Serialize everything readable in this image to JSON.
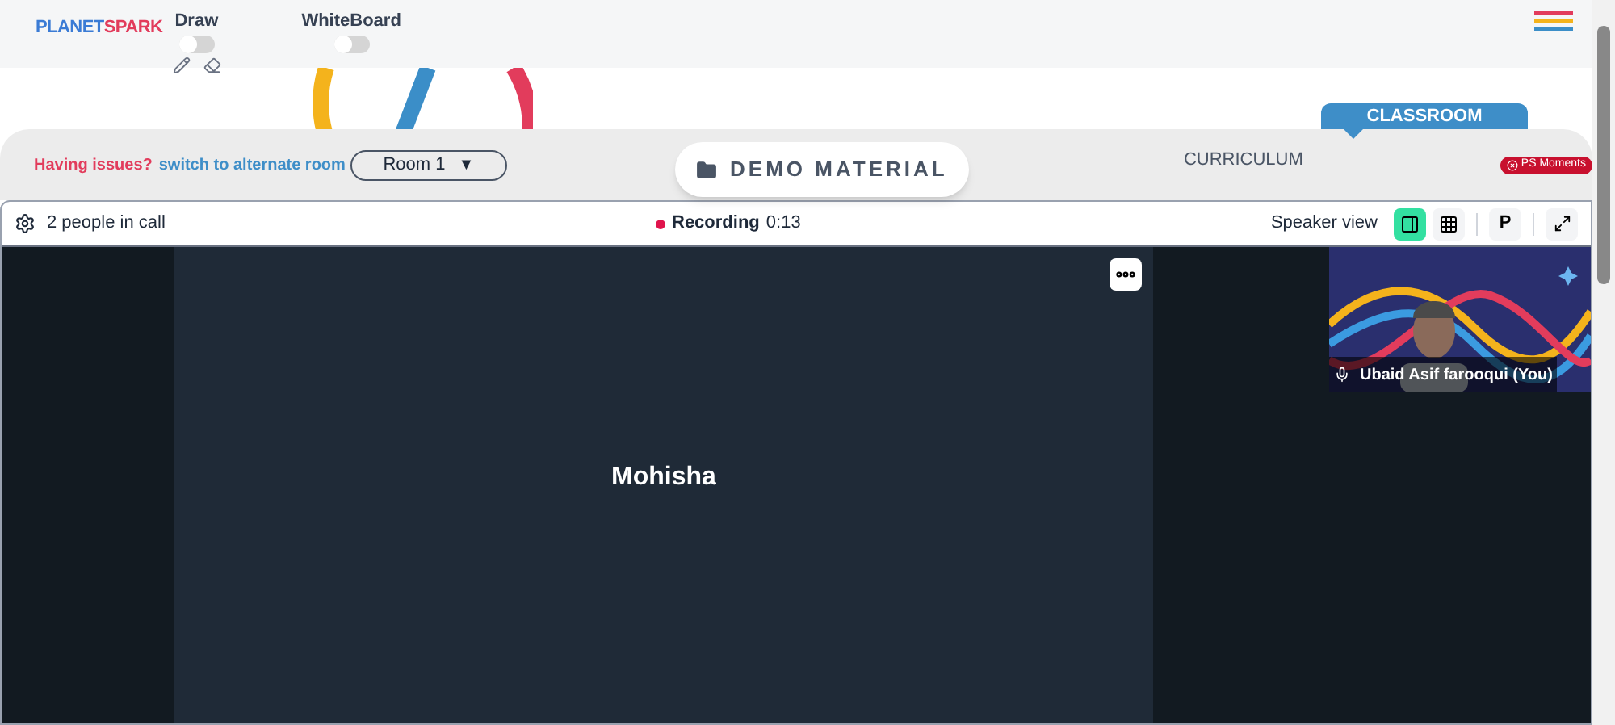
{
  "header": {
    "logo": "PLANETSPARK",
    "toggles": [
      {
        "label": "Draw",
        "on": false,
        "tools": true
      },
      {
        "label": "WhiteBoard",
        "on": false,
        "tools": false
      }
    ]
  },
  "tabs": [
    {
      "label": "CLASSROOM",
      "selected": true
    },
    {
      "label": "CURRICULUM",
      "selected": false
    }
  ],
  "room_bar": {
    "issue_text": "Having issues?",
    "switch_link": "switch to alternate room",
    "room_select": "Room 1",
    "room_caret": "▼",
    "demo_button": "DEMO MATERIAL",
    "badge": "PS Moments"
  },
  "call": {
    "people": "2 people in call",
    "recording_label": "Recording",
    "recording_time": "0:13",
    "view_label": "Speaker view",
    "view_buttons": [
      {
        "kind": "speaker",
        "selected": true
      },
      {
        "kind": "grid",
        "selected": false
      }
    ],
    "p_button": "P",
    "main_participant": "Mohisha",
    "self_view": {
      "name": "Ubaid Asif farooqui (You)"
    }
  }
}
